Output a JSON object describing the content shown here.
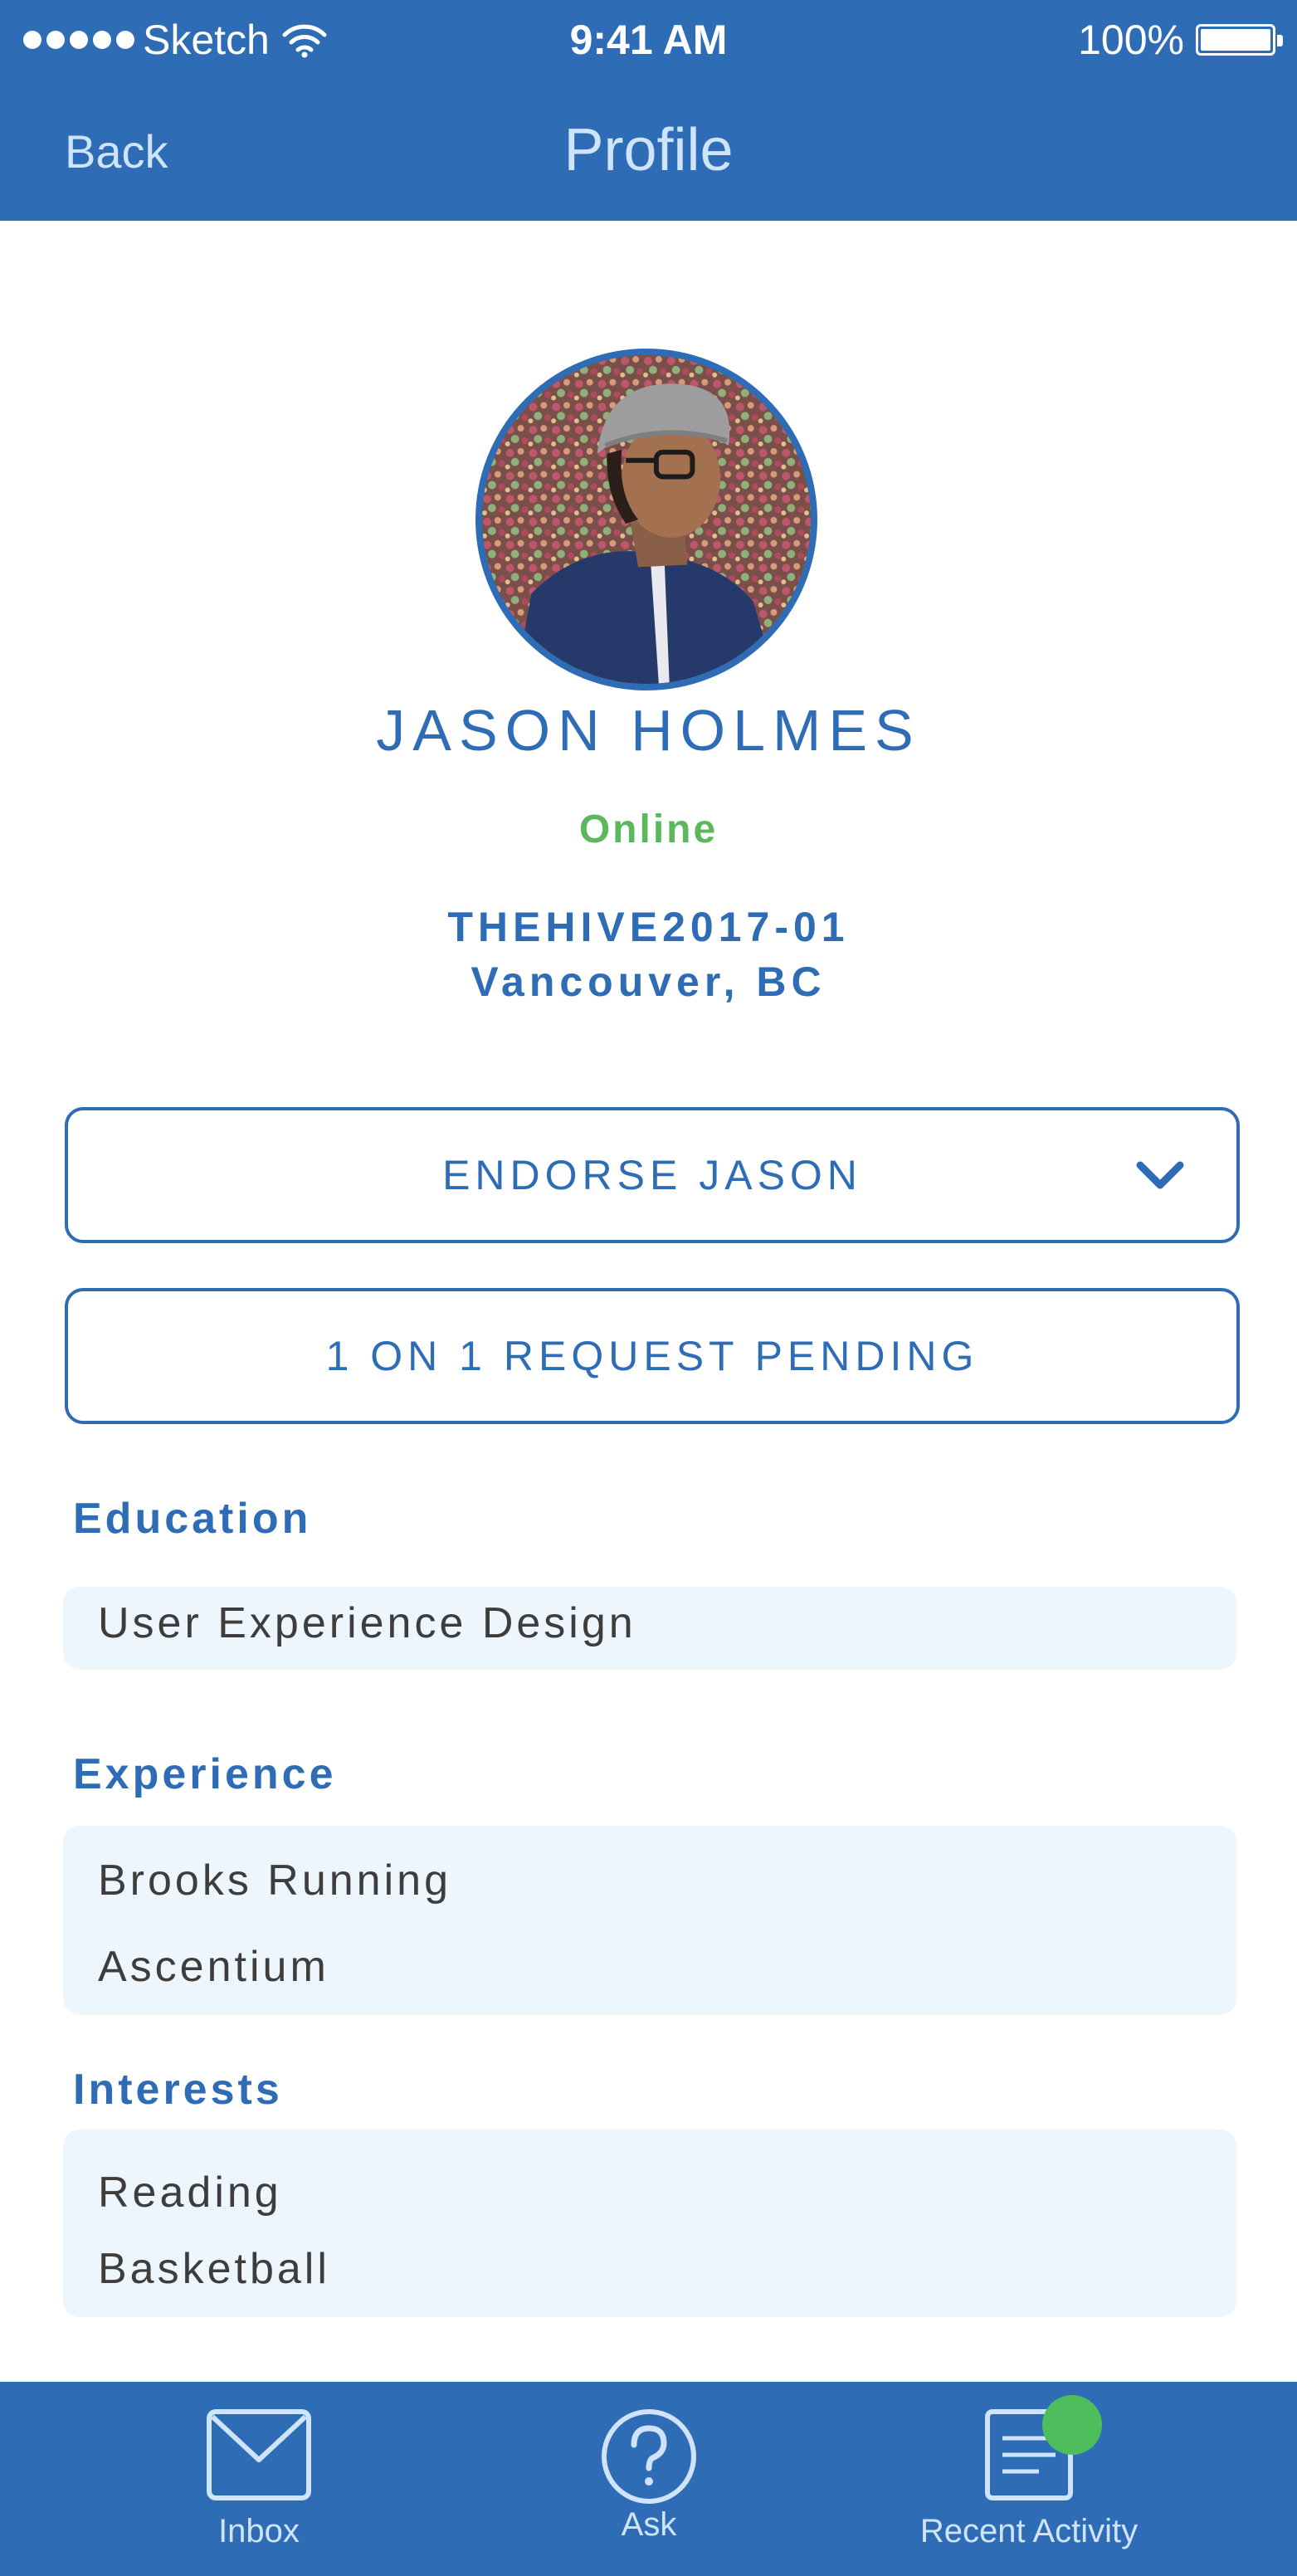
{
  "status_bar": {
    "carrier": "Sketch",
    "time": "9:41 AM",
    "battery": "100%",
    "battery_level": 1.0
  },
  "nav": {
    "back_label": "Back",
    "title": "Profile"
  },
  "profile": {
    "name": "JASON HOLMES",
    "status": "Online",
    "cohort": "THEHIVE2017-01",
    "location": "Vancouver, BC"
  },
  "actions": {
    "endorse_label": "ENDORSE JASON",
    "request_label": "1 ON 1 REQUEST PENDING"
  },
  "sections": {
    "education": {
      "label": "Education",
      "items": [
        "User Experience Design"
      ]
    },
    "experience": {
      "label": "Experience",
      "items": [
        "Brooks Running",
        "Ascentium"
      ]
    },
    "interests": {
      "label": "Interests",
      "items": [
        "Reading",
        "Basketball"
      ]
    }
  },
  "tabbar": {
    "items": [
      {
        "label": "Inbox",
        "icon": "envelope-icon"
      },
      {
        "label": "Ask",
        "icon": "question-icon"
      },
      {
        "label": "Recent Activity",
        "icon": "document-icon"
      }
    ]
  },
  "colors": {
    "primary": "#2e6db6",
    "online": "#5cb85c",
    "notification": "#4ebd5b",
    "card_bg": "#eef6fd",
    "nav_text": "#cfe3fb"
  }
}
